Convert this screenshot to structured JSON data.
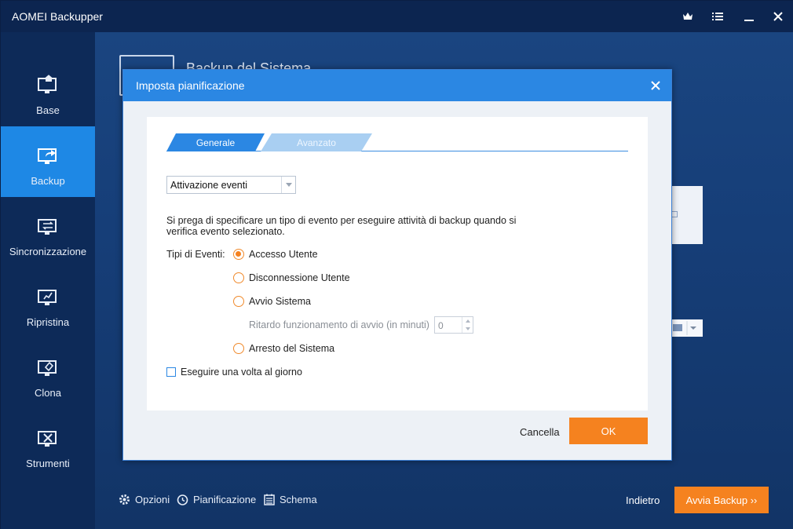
{
  "app": {
    "title": "AOMEI Backupper"
  },
  "titlebar": {
    "icons": [
      "crown-icon",
      "menu-icon",
      "minimize-icon",
      "close-icon"
    ]
  },
  "sidebar": {
    "items": [
      {
        "label": "Base",
        "icon": "monitor-home-icon",
        "active": false
      },
      {
        "label": "Backup",
        "icon": "monitor-export-icon",
        "active": true
      },
      {
        "label": "Sincronizzazione",
        "icon": "monitor-sync-icon",
        "active": false
      },
      {
        "label": "Ripristina",
        "icon": "monitor-restore-icon",
        "active": false
      },
      {
        "label": "Clona",
        "icon": "monitor-clone-icon",
        "active": false
      },
      {
        "label": "Strumenti",
        "icon": "monitor-tools-icon",
        "active": false
      }
    ]
  },
  "main": {
    "heading": "Backup del Sistema",
    "bottom": {
      "options": "Opzioni",
      "schedule": "Pianificazione",
      "scheme": "Schema",
      "back": "Indietro",
      "start": "Avvia Backup ››"
    }
  },
  "dialog": {
    "title": "Imposta pianificazione",
    "tabs": {
      "general": "Generale",
      "advanced": "Avanzato"
    },
    "mode_select": "Attivazione eventi",
    "description": "Si prega di specificare un tipo di evento per eseguire attività di backup quando si verifica evento selezionato.",
    "event_types_label": "Tipi di Eventi:",
    "events": [
      {
        "label": "Accesso Utente",
        "checked": true
      },
      {
        "label": "Disconnessione Utente",
        "checked": false
      },
      {
        "label": "Avvio Sistema",
        "checked": false
      },
      {
        "label": "Arresto del Sistema",
        "checked": false
      }
    ],
    "delay_label": "Ritardo funzionamento di avvio (in minuti)",
    "delay_value": "0",
    "once_a_day": "Eseguire una volta al giorno",
    "cancel": "Cancella",
    "ok": "OK"
  },
  "colors": {
    "accent_blue": "#2b87e3",
    "orange": "#f5821f",
    "dark_navy": "#0c2550"
  }
}
